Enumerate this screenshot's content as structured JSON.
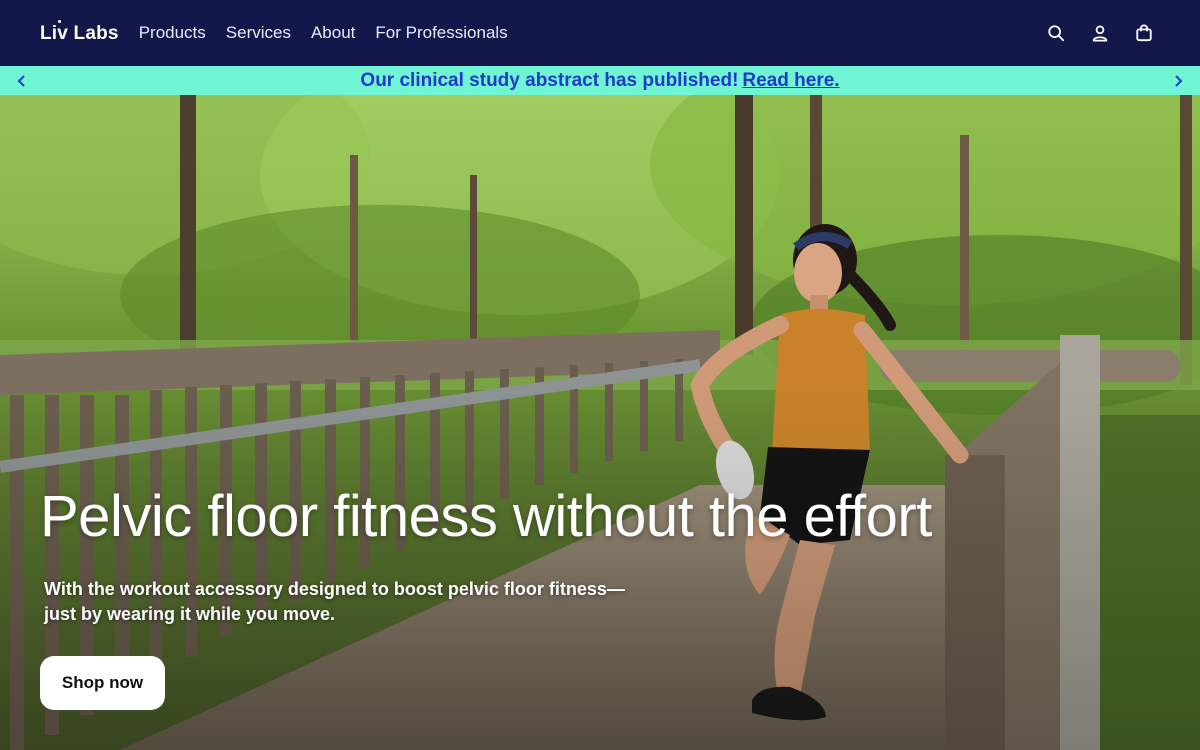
{
  "header": {
    "logo": "Liv Labs",
    "nav": [
      {
        "label": "Products"
      },
      {
        "label": "Services"
      },
      {
        "label": "About"
      },
      {
        "label": "For Professionals"
      }
    ],
    "icons": [
      "search-icon",
      "account-icon",
      "cart-icon"
    ]
  },
  "announcement": {
    "text": "Our clinical study abstract has published!",
    "link": "Read here.",
    "icons": [
      "chevron-left-icon",
      "chevron-right-icon"
    ]
  },
  "hero": {
    "title": "Pelvic floor fitness without the effort",
    "subtitle_line1": "With the workout accessory designed to boost pelvic floor fitness—",
    "subtitle_line2": "just by wearing it while you move.",
    "cta": "Shop now"
  },
  "colors": {
    "header_bg": "#14174a",
    "announcement_bg": "#6ff5d4",
    "announcement_text": "#1f39c9",
    "cta_bg": "#ffffff"
  }
}
